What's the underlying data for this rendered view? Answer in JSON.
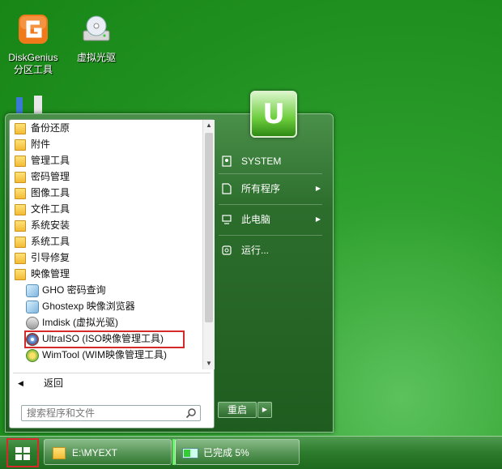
{
  "desktop": {
    "icons": [
      {
        "label_line1": "DiskGenius",
        "label_line2": "分区工具",
        "icon": "diskgenius-icon"
      },
      {
        "label_line1": "虚拟光驱",
        "label_line2": "",
        "icon": "virtual-drive-icon"
      }
    ]
  },
  "start_menu": {
    "programs": [
      {
        "label": "备份还原",
        "type": "folder"
      },
      {
        "label": "附件",
        "type": "folder"
      },
      {
        "label": "管理工具",
        "type": "folder"
      },
      {
        "label": "密码管理",
        "type": "folder"
      },
      {
        "label": "图像工具",
        "type": "folder"
      },
      {
        "label": "文件工具",
        "type": "folder"
      },
      {
        "label": "系统安装",
        "type": "folder"
      },
      {
        "label": "系统工具",
        "type": "folder"
      },
      {
        "label": "引导修复",
        "type": "folder"
      },
      {
        "label": "映像管理",
        "type": "folder"
      },
      {
        "label": "GHO 密码查询",
        "type": "app"
      },
      {
        "label": "Ghostexp 映像浏览器",
        "type": "app"
      },
      {
        "label": "Imdisk (虚拟光驱)",
        "type": "app"
      },
      {
        "label": "UltraISO (ISO映像管理工具)",
        "type": "app"
      },
      {
        "label": "WimTool (WIM映像管理工具)",
        "type": "app"
      }
    ],
    "back_label": "返回",
    "search_placeholder": "搜索程序和文件",
    "right": {
      "user": "SYSTEM",
      "all_programs": "所有程序",
      "this_pc": "此电脑",
      "run": "运行..."
    },
    "restart_label": "重启"
  },
  "taskbar": {
    "tasks": [
      {
        "label": "E:\\MYEXT"
      },
      {
        "label": "已完成 5%"
      }
    ]
  }
}
